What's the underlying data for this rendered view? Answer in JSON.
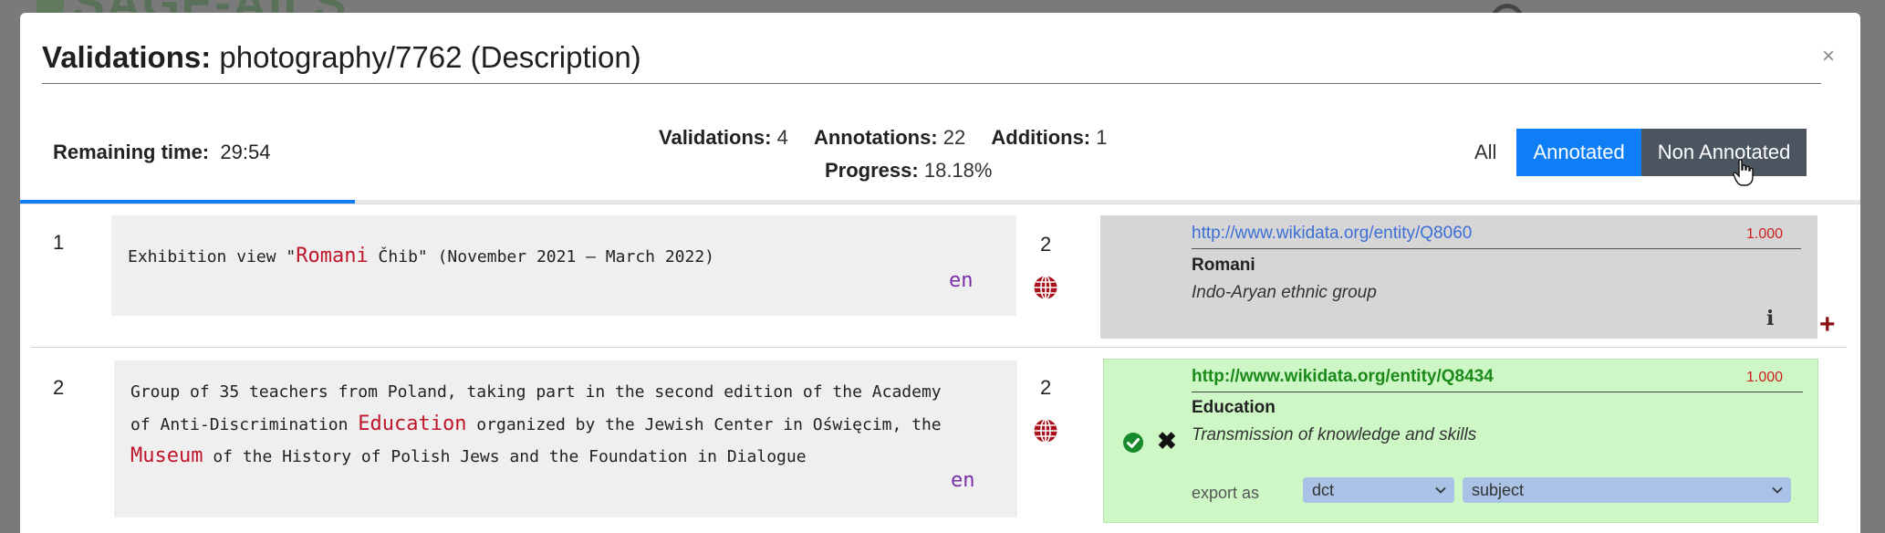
{
  "background": {
    "app_logo_text": "SAGE-AILS"
  },
  "modal": {
    "title_bold": "Validations:",
    "title_rest": " photography/7762 (Description)",
    "close_symbol": "×"
  },
  "header": {
    "remaining_label": "Remaining time:",
    "remaining_value": "29:54",
    "validations_label": "Validations:",
    "validations_value": "4",
    "annotations_label": "Annotations:",
    "annotations_value": "22",
    "additions_label": "Additions:",
    "additions_value": "1",
    "progress_label": "Progress:",
    "progress_value": "18.18%",
    "progress_fraction": 0.1818
  },
  "filters": {
    "all": "All",
    "annotated": "Annotated",
    "non_annotated": "Non Annotated",
    "active": "Annotated"
  },
  "rows": [
    {
      "index": "1",
      "text_parts": [
        "Exhibition view \"",
        "Romani",
        " Čhib\" (November 2021 – March 2022)"
      ],
      "lang": "en",
      "count": "2",
      "entity": {
        "url": "http://www.wikidata.org/entity/Q8060",
        "score": "1.000",
        "label": "Romani",
        "description": "Indo-Aryan ethnic group",
        "info_symbol": "i",
        "add_symbol": "+"
      }
    },
    {
      "index": "2",
      "line1": "Group of 35 teachers from Poland, taking part in the second edition of the Academy",
      "line2_a": "of Anti-Discrimination ",
      "line2_hl": "Education",
      "line2_b": " organized by the Jewish Center in Oświęcim, the",
      "line3_hl": "Museum",
      "line3_b": " of the History of Polish Jews and the Foundation in Dialogue",
      "lang": "en",
      "count": "2",
      "entity": {
        "url": "http://www.wikidata.org/entity/Q8434",
        "score": "1.000",
        "label": "Education",
        "description": "Transmission of knowledge and skills",
        "reject_symbol": "✖",
        "export_label": "export as",
        "export_prefix": "dct",
        "export_property": "subject"
      }
    }
  ],
  "colors": {
    "primary": "#0d7ef5",
    "highlight": "#c0152b",
    "lang": "#7a2da8",
    "validated_bg": "#cdf8c6",
    "pending_bg": "#d6d6d6"
  }
}
